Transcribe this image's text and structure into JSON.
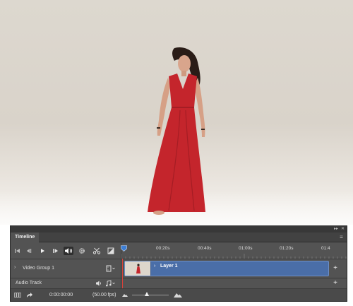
{
  "panel": {
    "tab_title": "Timeline",
    "window_controls": {
      "collapse": "▸▸",
      "close": "✕"
    },
    "menu_icon": "≡"
  },
  "controls": {
    "icons": [
      "go-to-first-frame-icon",
      "previous-frame-icon",
      "play-icon",
      "next-frame-icon",
      "audio-icon",
      "settings-gear-icon",
      "scissors-split-icon",
      "transition-icon"
    ]
  },
  "ruler": {
    "ticks": [
      "00:20s",
      "00:40s",
      "01:00s",
      "01:20s",
      "01:4"
    ]
  },
  "tracks": {
    "video_group": {
      "label": "Video Group 1",
      "clip_label": "Layer 1"
    },
    "audio": {
      "label": "Audio Track"
    }
  },
  "bottombar": {
    "timecode": "0:00:00:00",
    "fps": "(50.00 fps)",
    "zoom_level": 0.4
  },
  "colors": {
    "panel_bg": "#535353",
    "clip": "#4a6ea8",
    "playhead": "#d8423b",
    "dress": "#c4252c"
  }
}
